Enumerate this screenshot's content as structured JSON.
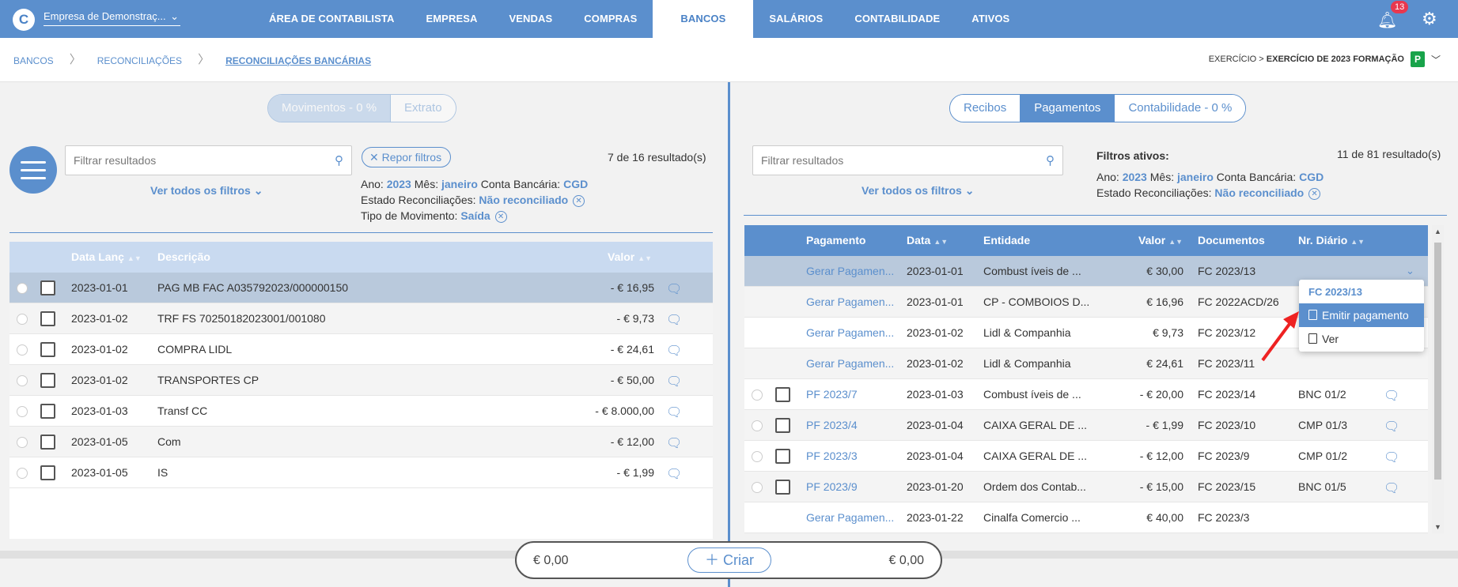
{
  "topbar": {
    "logo": "C",
    "company": "Empresa de Demonstraç...",
    "nav": [
      "ÁREA DE CONTABILISTA",
      "EMPRESA",
      "VENDAS",
      "COMPRAS",
      "BANCOS",
      "SALÁRIOS",
      "CONTABILIDADE",
      "ATIVOS"
    ],
    "active_nav": "BANCOS",
    "notifications": "13"
  },
  "breadcrumb": [
    "BANCOS",
    "RECONCILIAÇÕES",
    "RECONCILIAÇÕES BANCÁRIAS"
  ],
  "exercise": {
    "label": "EXERCÍCIO >",
    "value": "EXERCÍCIO DE 2023 FORMAÇÃO",
    "badge": "P"
  },
  "left": {
    "toggle": [
      "Movimentos - 0 %",
      "Extrato"
    ],
    "search_placeholder": "Filtrar resultados",
    "see_all": "Ver todos os filtros",
    "reset": "Repor filtros",
    "count": "7 de 16 resultado(s)",
    "filters": {
      "ano_label": "Ano:",
      "ano": "2023",
      "mes_label": "Mês:",
      "mes": "janeiro",
      "conta_label": "Conta Bancária:",
      "conta": "CGD",
      "estado_label": "Estado Reconciliações:",
      "estado": "Não reconciliado",
      "tipo_label": "Tipo de Movimento:",
      "tipo": "Saída"
    },
    "columns": [
      "Data Lanç",
      "Descrição",
      "Valor"
    ],
    "rows": [
      {
        "date": "2023-01-01",
        "desc": "PAG MB FAC A035792023/000000150",
        "value": "- € 16,95"
      },
      {
        "date": "2023-01-02",
        "desc": "TRF FS 70250182023001/001080",
        "value": "- € 9,73"
      },
      {
        "date": "2023-01-02",
        "desc": "COMPRA LIDL",
        "value": "- € 24,61"
      },
      {
        "date": "2023-01-02",
        "desc": "TRANSPORTES CP",
        "value": "- € 50,00"
      },
      {
        "date": "2023-01-03",
        "desc": "Transf CC",
        "value": "- € 8.000,00"
      },
      {
        "date": "2023-01-05",
        "desc": "Com",
        "value": "- € 12,00"
      },
      {
        "date": "2023-01-05",
        "desc": "IS",
        "value": "- € 1,99"
      }
    ]
  },
  "right": {
    "toggle": [
      "Recibos",
      "Pagamentos",
      "Contabilidade - 0 %"
    ],
    "search_placeholder": "Filtrar resultados",
    "see_all": "Ver todos os filtros",
    "active_filters": "Filtros ativos:",
    "count": "11 de 81 resultado(s)",
    "filters": {
      "ano_label": "Ano:",
      "ano": "2023",
      "mes_label": "Mês:",
      "mes": "janeiro",
      "conta_label": "Conta Bancária:",
      "conta": "CGD",
      "estado_label": "Estado Reconciliações:",
      "estado": "Não reconciliado"
    },
    "columns": [
      "Pagamento",
      "Data",
      "Entidade",
      "Valor",
      "Documentos",
      "Nr. Diário"
    ],
    "rows": [
      {
        "pay": "Gerar Pagamen...",
        "date": "2023-01-01",
        "entity": "Combust íveis de ...",
        "value": "€ 30,00",
        "doc": "FC 2023/13",
        "diary": ""
      },
      {
        "pay": "Gerar Pagamen...",
        "date": "2023-01-01",
        "entity": "CP - COMBOIOS D...",
        "value": "€ 16,96",
        "doc": "FC 2022ACD/26",
        "diary": ""
      },
      {
        "pay": "Gerar Pagamen...",
        "date": "2023-01-02",
        "entity": "Lidl & Companhia",
        "value": "€ 9,73",
        "doc": "FC 2023/12",
        "diary": ""
      },
      {
        "pay": "Gerar Pagamen...",
        "date": "2023-01-02",
        "entity": "Lidl & Companhia",
        "value": "€ 24,61",
        "doc": "FC 2023/11",
        "diary": ""
      },
      {
        "pay": "PF 2023/7",
        "date": "2023-01-03",
        "entity": "Combust íveis de ...",
        "value": "- € 20,00",
        "doc": "FC 2023/14",
        "diary": "BNC 01/2"
      },
      {
        "pay": "PF 2023/4",
        "date": "2023-01-04",
        "entity": "CAIXA GERAL DE ...",
        "value": "- € 1,99",
        "doc": "FC 2023/10",
        "diary": "CMP 01/3"
      },
      {
        "pay": "PF 2023/3",
        "date": "2023-01-04",
        "entity": "CAIXA GERAL DE ...",
        "value": "- € 12,00",
        "doc": "FC 2023/9",
        "diary": "CMP 01/2"
      },
      {
        "pay": "PF 2023/9",
        "date": "2023-01-20",
        "entity": "Ordem dos Contab...",
        "value": "- € 15,00",
        "doc": "FC 2023/15",
        "diary": "BNC 01/5"
      },
      {
        "pay": "Gerar Pagamen...",
        "date": "2023-01-22",
        "entity": "Cinalfa Comercio ...",
        "value": "€ 40,00",
        "doc": "FC 2023/3",
        "diary": ""
      }
    ],
    "context_menu": {
      "title": "FC 2023/13",
      "items": [
        "Emitir pagamento",
        "Ver"
      ]
    }
  },
  "totals": {
    "left": "€ 0,00",
    "create": "Criar",
    "right": "€ 0,00"
  },
  "colors": {
    "accent": "#5b8fcd",
    "badge": "#e8384f",
    "exercise": "#18a34a"
  }
}
